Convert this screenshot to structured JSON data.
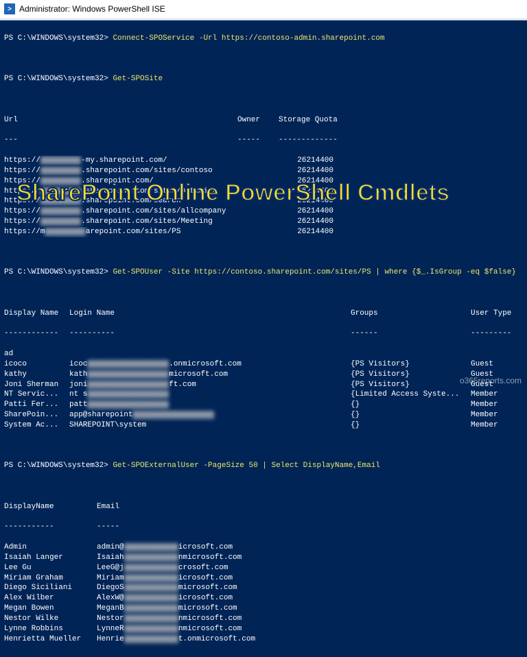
{
  "window": {
    "title": "Administrator: Windows PowerShell ISE"
  },
  "watermark": "o365reports.com",
  "overlay": "SharePoint Online PowerShell Cmdlets",
  "cmd1": {
    "prompt": "PS C:\\WINDOWS\\system32> ",
    "command": "Connect-SPOService -Url https://contoso-admin.sharepoint.com"
  },
  "cmd2": {
    "prompt": "PS C:\\WINDOWS\\system32> ",
    "command": "Get-SPOSite"
  },
  "sites": {
    "headers": {
      "url": "Url",
      "owner": "Owner",
      "quota": "Storage Quota"
    },
    "dashes": {
      "url": "---",
      "owner": "-----",
      "quota": "-------------"
    },
    "rows": [
      {
        "pre": "https://",
        "suf": "-my.sharepoint.com/",
        "quota": "26214400"
      },
      {
        "pre": "https://",
        "suf": ".sharepoint.com/sites/contoso",
        "quota": "26214400"
      },
      {
        "pre": "https://",
        "suf": ".sharepoint.com/",
        "quota": "26214400"
      },
      {
        "pre": "https://",
        "suf": ".sharepoint.com/sites/DataSite",
        "quota": "26214400"
      },
      {
        "pre": "https://",
        "suf": ".sharepoint.com/search",
        "quota": "26214400"
      },
      {
        "pre": "https://",
        "suf": ".sharepoint.com/sites/allcompany",
        "quota": "26214400"
      },
      {
        "pre": "https://",
        "suf": ".sharepoint.com/sites/Meeting",
        "quota": "26214400"
      },
      {
        "pre": "https://m",
        "suf": "arepoint.com/sites/PS",
        "quota": "26214400"
      }
    ]
  },
  "cmd3": {
    "prompt": "PS C:\\WINDOWS\\system32> ",
    "command": "Get-SPOUser -Site https://contoso.sharepoint.com/sites/PS | where {$_.IsGroup -eq $false}"
  },
  "users": {
    "headers": {
      "dn": "Display Name",
      "ln": "Login Name",
      "groups": "Groups",
      "type": "User Type"
    },
    "dashes": {
      "dn": "------------",
      "ln": "----------",
      "groups": "------",
      "type": "---------"
    },
    "rows": [
      {
        "dn": "ad",
        "ln": "",
        "groups": "",
        "type": ""
      },
      {
        "dn": "icoco",
        "ln": "icoc",
        "ln_suf": ".onmicrosoft.com",
        "groups": "{PS Visitors}",
        "type": "Guest"
      },
      {
        "dn": "kathy",
        "ln": "kath",
        "ln_suf": "microsoft.com",
        "groups": "{PS Visitors}",
        "type": "Guest"
      },
      {
        "dn": "Joni Sherman",
        "ln": "joni",
        "ln_suf": "ft.com",
        "groups": "{PS Visitors}",
        "type": "Guest"
      },
      {
        "dn": "NT Servic...",
        "ln": "nt s",
        "ln_suf": "",
        "groups": "{Limited Access Syste...",
        "type": "Member"
      },
      {
        "dn": "Patti Fer...",
        "ln": "patt",
        "ln_suf": "",
        "groups": "{}",
        "type": "Member"
      },
      {
        "dn": "SharePoin...",
        "ln": "app@sharepoint",
        "ln_suf": "",
        "groups": "{}",
        "type": "Member"
      },
      {
        "dn": "System Ac...",
        "ln": "SHAREPOINT\\system",
        "ln_suf": "",
        "groups": "{}",
        "type": "Member"
      }
    ]
  },
  "cmd4": {
    "prompt": "PS C:\\WINDOWS\\system32> ",
    "command": "Get-SPOExternalUser -PageSize 50 | Select DisplayName,Email"
  },
  "ext": {
    "headers": {
      "dn": "DisplayName",
      "email": "Email"
    },
    "dashes": {
      "dn": "-----------",
      "email": "-----"
    },
    "rows": [
      {
        "dn": "Admin",
        "pre": "admin@",
        "suf": "icrosoft.com"
      },
      {
        "dn": "Isaiah Langer",
        "pre": "Isaiah",
        "suf": "nmicrosoft.com"
      },
      {
        "dn": "Lee Gu",
        "pre": "LeeG@j",
        "suf": "crosoft.com"
      },
      {
        "dn": "Miriam Graham",
        "pre": "Miriam",
        "suf": "icrosoft.com"
      },
      {
        "dn": "Diego Siciliani",
        "pre": "DiegoS",
        "suf": "microsoft.com"
      },
      {
        "dn": "Alex Wilber",
        "pre": "AlexW@",
        "suf": "icrosoft.com"
      },
      {
        "dn": "Megan Bowen",
        "pre": "MeganB",
        "suf": "microsoft.com"
      },
      {
        "dn": "Nestor Wilke",
        "pre": "Nestor",
        "suf": "nmicrosoft.com"
      },
      {
        "dn": "Lynne Robbins",
        "pre": "LynneR",
        "suf": "nmicrosoft.com"
      },
      {
        "dn": "Henrietta Mueller",
        "pre": "Henrie",
        "suf": "t.onmicrosoft.com"
      }
    ]
  }
}
